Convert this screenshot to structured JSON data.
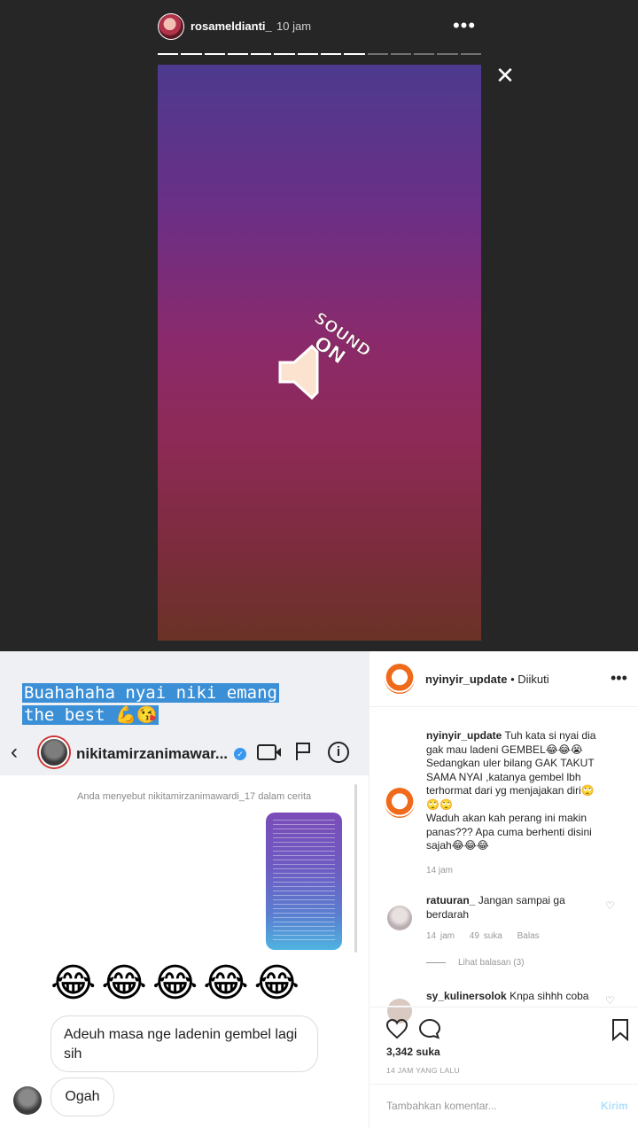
{
  "story": {
    "username": "rosameldianti_",
    "time": "10 jam",
    "more_icon": "•••",
    "close_icon": "✕",
    "progress": {
      "total_segments": 14,
      "completed_segments": 9
    },
    "sticker_text": "SOUND ON"
  },
  "screenshot": {
    "caption_line1": "Buahahaha nyai niki emang",
    "caption_line2": "the best 💪😘",
    "dm_username": "nikitamirzanimawar...",
    "verified_icon": "✓",
    "back_icon": "‹",
    "info_icon": "i",
    "mention_text": "Anda menyebut nikitamirzanimawardi_17 dalam cerita",
    "emojis": "😂😂😂😂😂",
    "message1": "Adeuh masa nge ladenin gembel lagi sih",
    "message2": "Ogah"
  },
  "post": {
    "username": "nyinyir_update",
    "follow_status": "• Diikuti",
    "more_icon": "•••",
    "caption_user": "nyinyir_update",
    "caption_text": "Tuh kata si nyai dia gak mau ladeni GEMBEL😂😂😭 Sedangkan uler bilang GAK TAKUT SAMA NYAI ,katanya gembel lbh terhormat dari yg menjajakan diri🙄🙄🙄",
    "caption_text2": "Waduh akan kah perang ini makin panas??? Apa cuma berhenti disini sajah😂😂😂",
    "caption_time": "14 jam",
    "comment1": {
      "user": "ratuuran_",
      "text": "Jangan sampai ga berdarah",
      "time": "14 jam",
      "likes": "49 suka",
      "reply": "Balas",
      "view_replies": "Lihat balasan (3)"
    },
    "comment2": {
      "user": "sy_kulinersolok",
      "text": "Knpa sihhh coba"
    },
    "likes_count": "3,342",
    "likes_label": "suka",
    "date": "14 JAM YANG LALU",
    "comment_placeholder": "Tambahkan komentar...",
    "post_button": "Kirim"
  }
}
